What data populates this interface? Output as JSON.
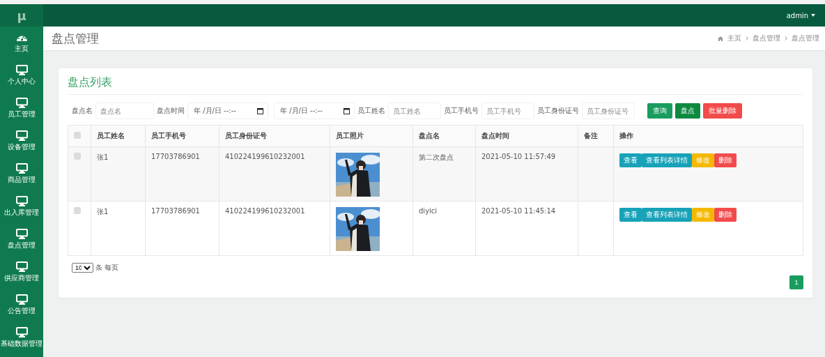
{
  "logo": "μ",
  "user_menu": {
    "label": "admin"
  },
  "sidebar": {
    "items": [
      {
        "label": "主页",
        "kind": "dashboard",
        "selected": false
      },
      {
        "label": "个人中心",
        "kind": "monitor",
        "selected": false
      },
      {
        "label": "员工管理",
        "kind": "monitor",
        "selected": false
      },
      {
        "label": "设备管理",
        "kind": "monitor",
        "selected": false
      },
      {
        "label": "商品管理",
        "kind": "monitor",
        "selected": false
      },
      {
        "label": "出入库管理",
        "kind": "monitor",
        "selected": false
      },
      {
        "label": "盘点管理",
        "kind": "monitor",
        "selected": false
      },
      {
        "label": "供应商管理",
        "kind": "monitor",
        "selected": false
      },
      {
        "label": "公告管理",
        "kind": "monitor",
        "selected": false
      },
      {
        "label": "基础数据管理",
        "kind": "monitor",
        "selected": false
      }
    ]
  },
  "page_title": "盘点管理",
  "breadcrumb": [
    "主页",
    "盘点管理",
    "盘点管理"
  ],
  "card_title": "盘点列表",
  "filters": [
    {
      "label": "盘点名",
      "kind": "text",
      "placeholder": "盘点名"
    },
    {
      "label": "盘点时间",
      "kind": "datetime",
      "placeholder": "年 /月/日 --:--"
    },
    {
      "kind": "datetime",
      "placeholder": "年 /月/日 --:--"
    },
    {
      "label": "员工姓名",
      "kind": "text",
      "placeholder": "员工姓名"
    },
    {
      "label": "员工手机号",
      "kind": "text",
      "placeholder": "员工手机号"
    },
    {
      "label": "员工身份证号",
      "kind": "text",
      "placeholder": "员工身份证号"
    }
  ],
  "actions": [
    {
      "label": "查询",
      "kind": "success"
    },
    {
      "label": "盘点",
      "kind": "primary"
    },
    {
      "label": "批量删除",
      "kind": "danger"
    }
  ],
  "table": {
    "columns": [
      "员工姓名",
      "员工手机号",
      "员工身份证号",
      "员工照片",
      "盘点名",
      "盘点时间",
      "备注",
      "操作"
    ],
    "header_checked": false,
    "rows": [
      {
        "checked": false,
        "cells": [
          "张1",
          "17703786901",
          "410224199610232001",
          {
            "kind": "picture"
          },
          "第二次盘点",
          "2021-05-10 11:57:49"
        ],
        "buttons": [
          {
            "label": "查看",
            "kind": "info"
          },
          {
            "label": "查看列表详情",
            "kind": "info"
          },
          {
            "label": "修改",
            "kind": "warning"
          },
          {
            "label": "删除",
            "kind": "danger"
          }
        ]
      },
      {
        "checked": false,
        "cells": [
          "张1",
          "17703786901",
          "410224199610232001",
          {
            "kind": "picture"
          },
          "diyici",
          "2021-05-10 11:45:14"
        ],
        "buttons": [
          {
            "label": "查看",
            "kind": "info"
          },
          {
            "label": "查看列表详情",
            "kind": "info"
          },
          {
            "label": "修改",
            "kind": "warning"
          },
          {
            "label": "删除",
            "kind": "danger"
          }
        ]
      }
    ]
  },
  "page_size": {
    "value": "10",
    "label": "条 每页"
  },
  "pagination": [
    {
      "label": "1",
      "selected": true
    }
  ]
}
